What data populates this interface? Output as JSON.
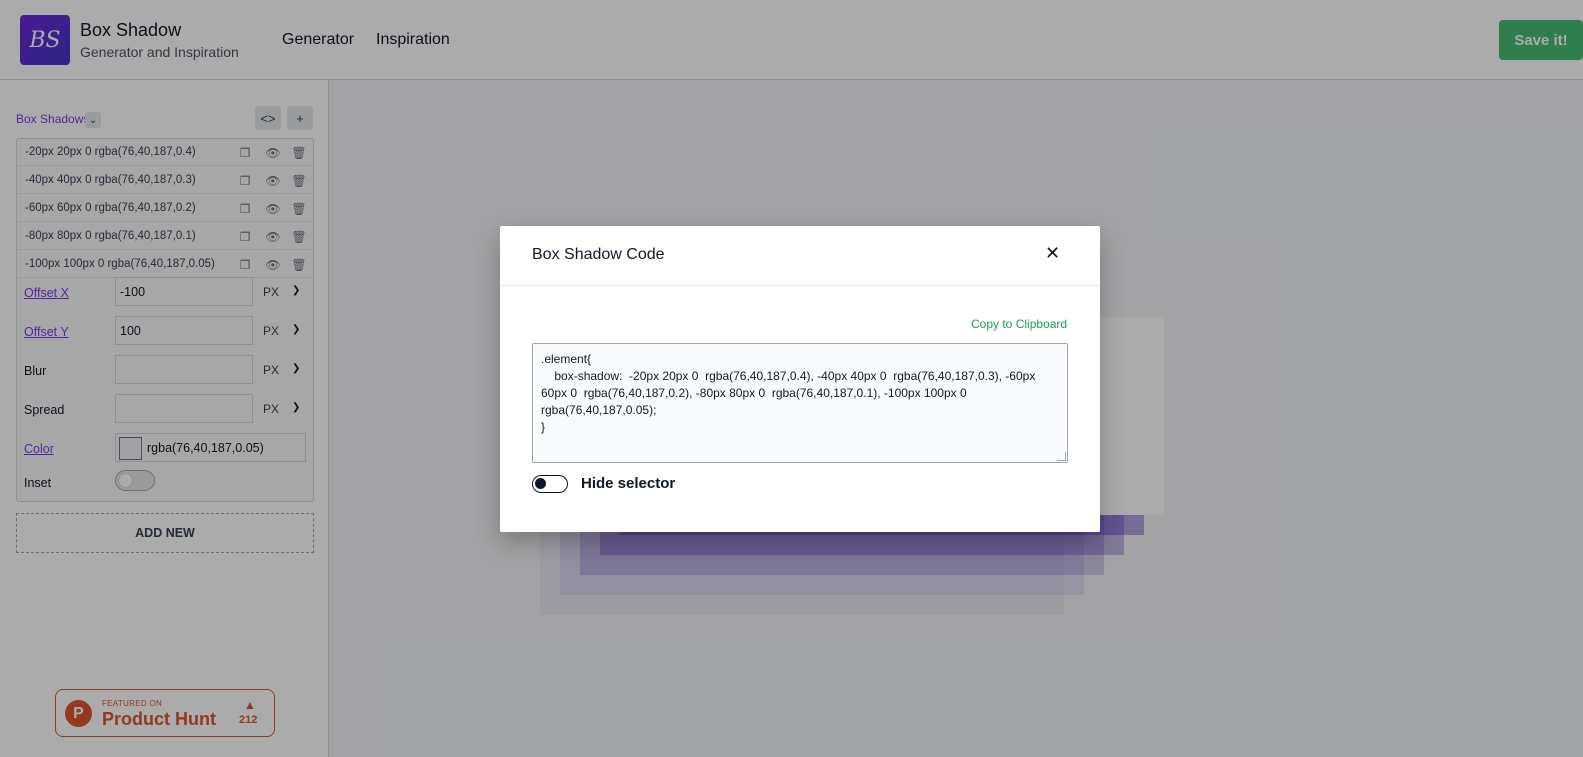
{
  "header": {
    "logo_text": "BS",
    "title": "Box Shadow",
    "subtitle": "Generator and Inspiration",
    "nav": [
      "Generator",
      "Inspiration"
    ],
    "save_label": "Save it!"
  },
  "sidebar": {
    "section_label": "Box Shadows",
    "shadows": [
      "-20px 20px 0 rgba(76,40,187,0.4)",
      "-40px 40px 0 rgba(76,40,187,0.3)",
      "-60px 60px 0 rgba(76,40,187,0.2)",
      "-80px 80px 0 rgba(76,40,187,0.1)",
      "-100px 100px 0 rgba(76,40,187,0.05)"
    ],
    "props": {
      "offset_x": {
        "label": "Offset X",
        "value": "-100",
        "unit": "PX"
      },
      "offset_y": {
        "label": "Offset Y",
        "value": "100",
        "unit": "PX"
      },
      "blur": {
        "label": "Blur",
        "value": "",
        "unit": "PX"
      },
      "spread": {
        "label": "Spread",
        "value": "",
        "unit": "PX"
      },
      "color": {
        "label": "Color",
        "value": "rgba(76,40,187,0.05)"
      },
      "inset": {
        "label": "Inset",
        "on": false
      }
    },
    "add_new_label": "ADD NEW"
  },
  "product_hunt": {
    "featured": "FEATURED ON",
    "name": "Product Hunt",
    "count": "212"
  },
  "modal": {
    "title": "Box Shadow Code",
    "copy_label": "Copy to Clipboard",
    "code": ".element{\n    box-shadow:  -20px 20px 0  rgba(76,40,187,0.4), -40px 40px 0  rgba(76,40,187,0.3), -60px 60px 0  rgba(76,40,187,0.2), -80px 80px 0  rgba(76,40,187,0.1), -100px 100px 0  rgba(76,40,187,0.05);\n}",
    "hide_selector_label": "Hide selector"
  },
  "colors": {
    "accent_purple": "#7c3aed",
    "save_green": "#48bb78",
    "copy_green": "#16a34a",
    "product_hunt": "#da552f"
  }
}
